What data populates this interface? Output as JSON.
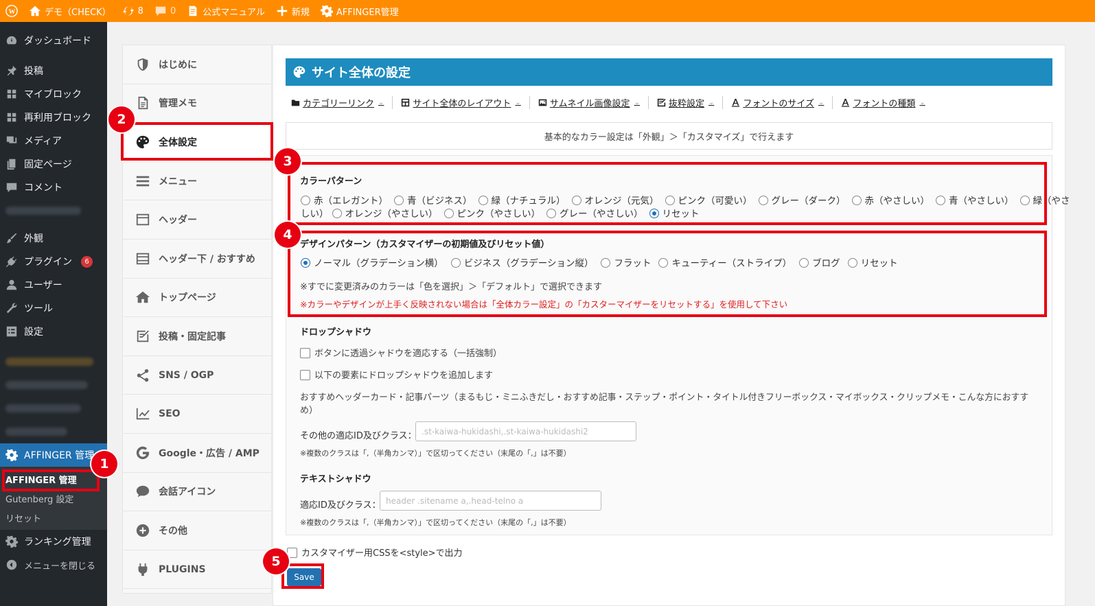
{
  "adminbar": {
    "site_name": "デモ（CHECK）",
    "updates": "8",
    "comments": "0",
    "manual": "公式マニュアル",
    "new": "新規",
    "affinger": "AFFINGER管理"
  },
  "wpmenu": {
    "dashboard": "ダッシュボード",
    "posts": "投稿",
    "myblocks": "マイブロック",
    "reusable": "再利用ブロック",
    "media": "メディア",
    "pages": "固定ページ",
    "comments": "コメント",
    "appearance": "外観",
    "plugins": "プラグイン",
    "plugins_badge": "6",
    "users": "ユーザー",
    "tools": "ツール",
    "settings": "設定",
    "affinger": "AFFINGER 管理",
    "sub_affinger": "AFFINGER 管理",
    "sub_gutenberg": "Gutenberg 設定",
    "sub_reset": "リセット",
    "ranking": "ランキング管理",
    "collapse": "メニューを閉じる"
  },
  "affnav": {
    "items": [
      "はじめに",
      "管理メモ",
      "全体設定",
      "メニュー",
      "ヘッダー",
      "ヘッダー下 / おすすめ",
      "トップページ",
      "投稿・固定記事",
      "SNS / OGP",
      "SEO",
      "Google・広告 / AMP",
      "会話アイコン",
      "その他",
      "PLUGINS"
    ]
  },
  "main": {
    "title": "サイト全体の設定",
    "tabs": [
      "カテゴリーリンク",
      "サイト全体のレイアウト",
      "サムネイル画像設定",
      "抜粋設定",
      "フォントのサイズ",
      "フォントの種類"
    ],
    "notice": "基本的なカラー設定は「外観」＞「カスタマイズ」で行えます",
    "color_title": "カラーパターン",
    "color_opts": [
      "赤（エレガント）",
      "青（ビジネス）",
      "緑（ナチュラル）",
      "オレンジ（元気）",
      "ピンク（可愛い）",
      "グレー（ダーク）",
      "赤（やさしい）",
      "青（やさしい）",
      "緑（やさ"
    ],
    "color_opts2_prefix": "しい）",
    "color_opts2": [
      "オレンジ（やさしい）",
      "ピンク（やさしい）",
      "グレー（やさしい）",
      "リセット"
    ],
    "design_title": "デザインパターン（カスタマイザーの初期値及びリセット値）",
    "design_opts": [
      "ノーマル（グラデーション横）",
      "ビジネス（グラデーション縦）",
      "フラット",
      "キューティー（ストライプ）",
      "ブログ",
      "リセット"
    ],
    "design_note": "※すでに変更済みのカラーは「色を選択」＞「デフォルト」で選択できます",
    "design_warn": "※カラーやデザインが上手く反映されない場合は「全体カラー設定」の「カスターマイザーをリセットする」を使用して下さい",
    "shadow_title": "ドロップシャドウ",
    "shadow_chk1": "ボタンに透過シャドウを適応する（一括強制）",
    "shadow_chk2": "以下の要素にドロップシャドウを追加します",
    "shadow_desc": "おすすめヘッダーカード・記事パーツ（まるもじ・ミニふきだし・おすすめ記事・ステップ・ポイント・タイトル付きフリーボックス・マイボックス・クリップメモ・こんな方におすす",
    "shadow_desc2": "め）",
    "other_label": "その他の適応ID及びクラス：",
    "other_placeholder": ".st-kaiwa-hukidashi,.st-kaiwa-hukidashi2",
    "other_hint": "※複数のクラスは「,（半角カンマ）」で区切ってください（末尾の「,」は不要）",
    "text_title": "テキストシャドウ",
    "text_label": "適応ID及びクラス：",
    "text_placeholder": "header .sitename a,.head-telno a",
    "text_hint": "※複数のクラスは「,（半角カンマ）」で区切ってください（末尾の「,」は不要）",
    "output_css": "カスタマイザー用CSSを<style>で出力",
    "save": "Save"
  },
  "annotations": [
    "1",
    "2",
    "3",
    "4",
    "5"
  ]
}
